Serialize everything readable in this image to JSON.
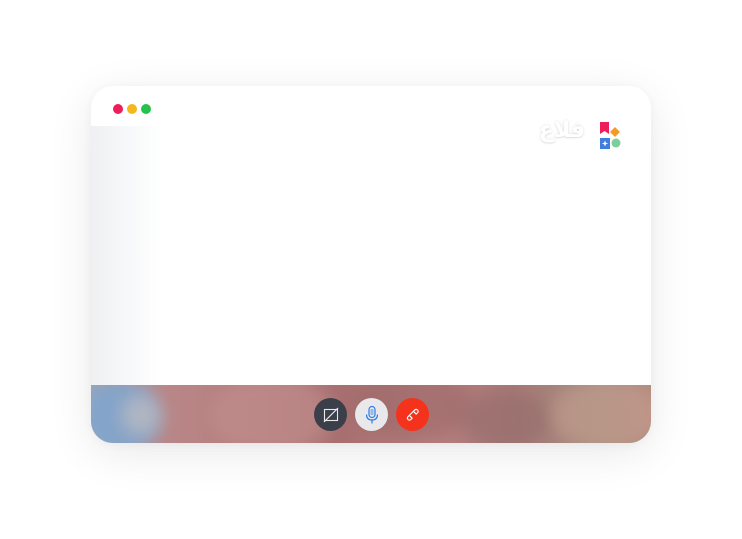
{
  "window": {
    "traffic_lights": [
      {
        "name": "close",
        "color": "#ee1e5a"
      },
      {
        "name": "minimize",
        "color": "#f5b71a"
      },
      {
        "name": "maximize",
        "color": "#27c24c"
      }
    ]
  },
  "brand": {
    "logo_text": "قلاع",
    "mark_colors": {
      "flag": "#ee1e5a",
      "diamond": "#f59a24",
      "square": "#3f7de0",
      "circle": "#7bcf9a"
    }
  },
  "call_controls": {
    "camera": {
      "icon": "camera-off-icon",
      "state": "off",
      "color": "#3a3f4a"
    },
    "microphone": {
      "icon": "microphone-icon",
      "state": "on",
      "color": "#e9e9ec",
      "icon_color": "#2f7be5"
    },
    "hangup": {
      "icon": "phone-hangup-icon",
      "color": "#f5321b"
    }
  }
}
